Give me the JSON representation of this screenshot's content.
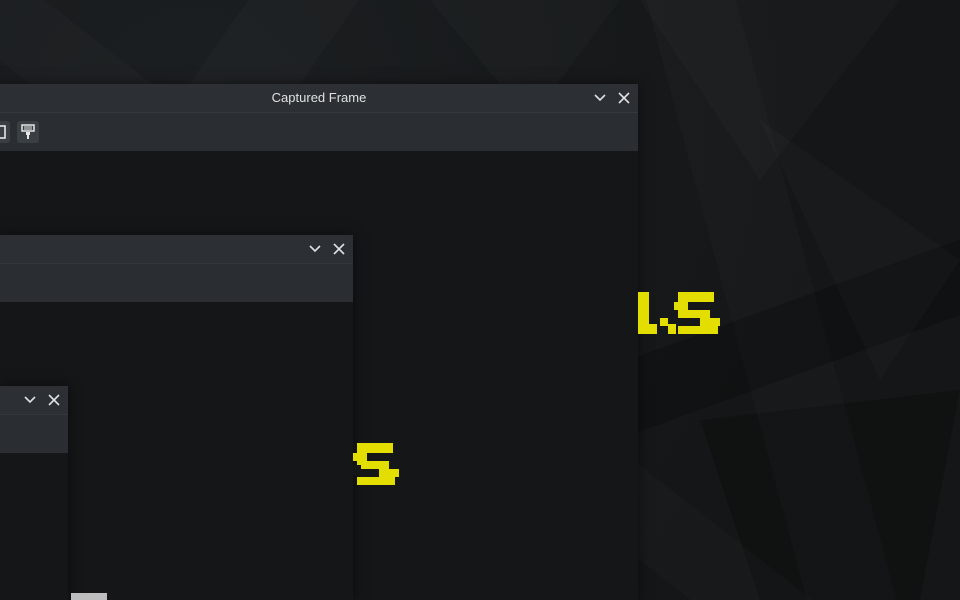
{
  "desktop": {
    "wallpaper": "dark-abstract",
    "accent_colors": {
      "overlay_text": "#e3dd00",
      "titlebar": "#2c3034",
      "toolbar": "#2a2e32",
      "content": "#141617"
    }
  },
  "windows": [
    {
      "title": "Captured Frame",
      "buttons": [
        "chevron-down-icon",
        "close-icon"
      ],
      "toolbar_icons": [
        "frame-icon",
        "paint-roller-icon"
      ]
    },
    {
      "title": "",
      "buttons": [
        "chevron-down-icon",
        "close-icon"
      ]
    },
    {
      "title": "",
      "buttons": [
        "chevron-down-icon",
        "close-icon"
      ]
    }
  ]
}
